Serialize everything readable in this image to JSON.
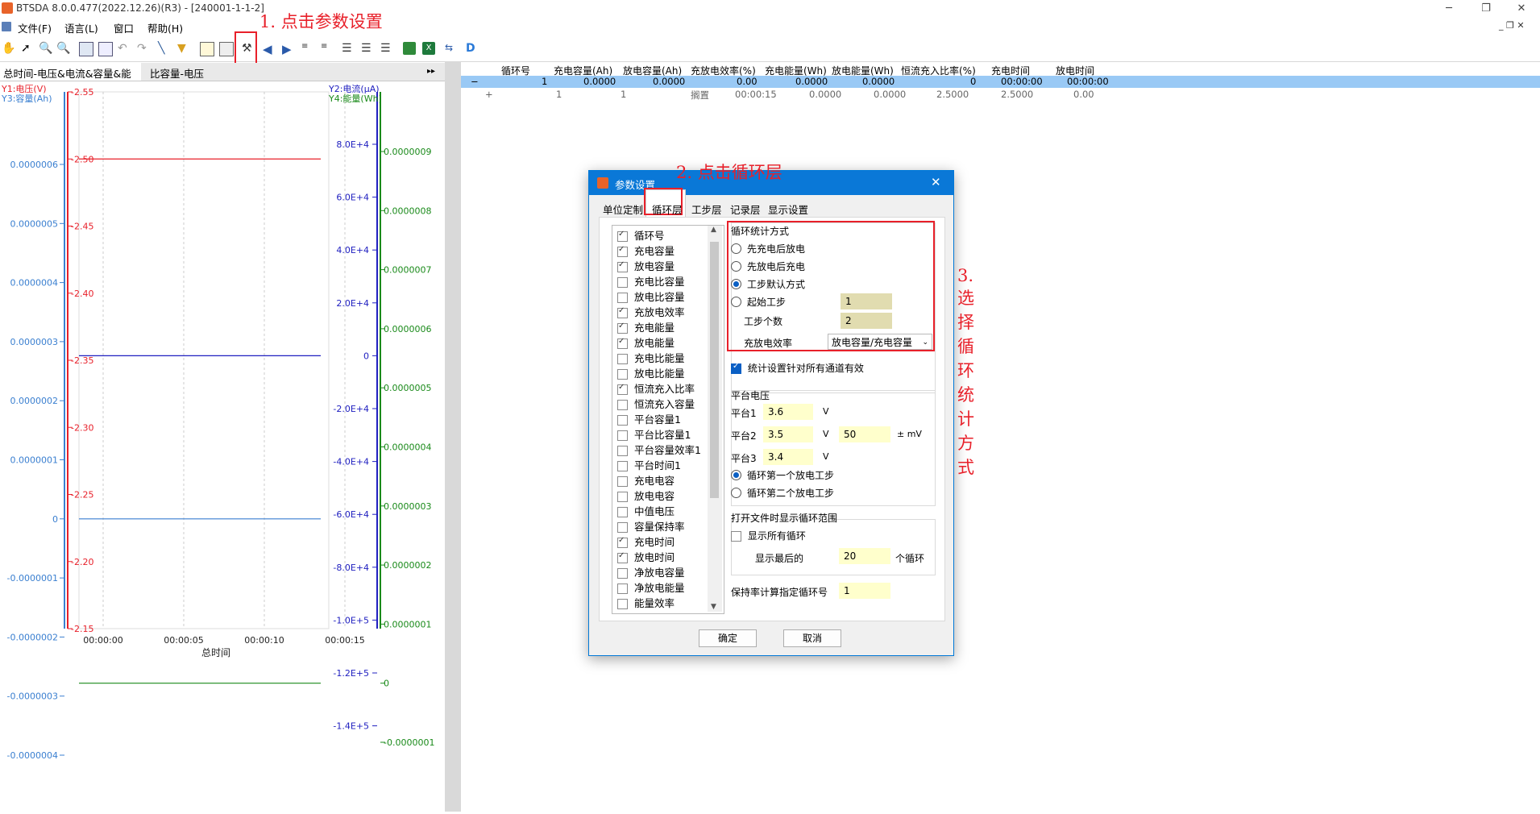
{
  "window": {
    "title": "BTSDA 8.0.0.477(2022.12.26)(R3) - [240001-1-1-2]",
    "minimize": "─",
    "restore": "❐",
    "close": "✕"
  },
  "menu": {
    "items": [
      "文件(F)",
      "语言(L)",
      "窗口",
      "帮助(H)"
    ]
  },
  "annotations": {
    "step1": "1. 点击参数设置",
    "step2": "2. 点击循环层",
    "step3": "3. 选择循环统计方式"
  },
  "left_panel": {
    "tabs": [
      "总时间-电压&电流&容量&能量",
      "比容量-电压"
    ],
    "arrow": "▸▸"
  },
  "chart_data": {
    "type": "line",
    "xlabel": "总时间",
    "x_ticks": [
      "00:00:00",
      "00:00:05",
      "00:00:10",
      "00:00:15"
    ],
    "axes": {
      "y1": {
        "label": "Y1:电压(V)",
        "color": "#e8202a",
        "ticks": [
          "2.55",
          "2.50",
          "2.45",
          "2.40",
          "2.35",
          "2.30",
          "2.25",
          "2.20",
          "2.15"
        ]
      },
      "y2": {
        "label": "Y2:电流(μA)",
        "color": "#2020c0",
        "ticks": [
          "8.0E+4",
          "6.0E+4",
          "4.0E+4",
          "2.0E+4",
          "0",
          "-2.0E+4",
          "-4.0E+4",
          "-6.0E+4",
          "-8.0E+4",
          "-1.0E+5",
          "-1.2E+5",
          "-1.4E+5"
        ]
      },
      "y3": {
        "label": "Y3:容量(Ah)",
        "color": "#3a7fd0",
        "ticks": [
          "0.0000006",
          "0.0000005",
          "0.0000004",
          "0.0000003",
          "0.0000002",
          "0.0000001",
          "0",
          "-0.0000001",
          "-0.0000002",
          "-0.0000003",
          "-0.0000004"
        ]
      },
      "y4": {
        "label": "Y4:能量(Wh)",
        "color": "#1a8a1a",
        "ticks": [
          "0.0000009",
          "0.0000008",
          "0.0000007",
          "0.0000006",
          "0.0000005",
          "0.0000004",
          "0.0000003",
          "0.0000002",
          "0.0000001",
          "0",
          "-0.0000001"
        ]
      }
    },
    "series": [
      {
        "name": "Y1:电压(V)",
        "color": "#e8202a",
        "x": [
          0,
          15
        ],
        "y": [
          2.5,
          2.5
        ]
      },
      {
        "name": "Y2:电流(μA)",
        "color": "#2020c0",
        "x": [
          0,
          15
        ],
        "y": [
          0,
          0
        ]
      },
      {
        "name": "Y3:容量(Ah)",
        "color": "#3a7fd0",
        "x": [
          0,
          15
        ],
        "y": [
          0,
          0
        ]
      },
      {
        "name": "Y4:能量(Wh)",
        "color": "#1a8a1a",
        "x": [
          0,
          15
        ],
        "y": [
          0,
          0
        ]
      }
    ]
  },
  "grid": {
    "headers": [
      "循环号",
      "充电容量(Ah)",
      "放电容量(Ah)",
      "充放电效率(%)",
      "充电能量(Wh)",
      "放电能量(Wh)",
      "恒流充入比率(%)",
      "充电时间",
      "放电时间"
    ],
    "row1": {
      "toggle": "−",
      "cells": [
        "1",
        "0.0000",
        "0.0000",
        "0.00",
        "0.0000",
        "0.0000",
        "0",
        "00:00:00",
        "00:00:00"
      ]
    },
    "row2": {
      "toggle": "+",
      "cells": [
        "1",
        "1",
        "搁置",
        "00:00:15",
        "0.0000",
        "0.0000",
        "2.5000",
        "2.5000",
        "0.00"
      ]
    }
  },
  "dialog": {
    "title": "参数设置",
    "close": "✕",
    "tabs": [
      "单位定制",
      "循环层",
      "工步层",
      "记录层",
      "显示设置"
    ],
    "columns": [
      {
        "label": "循环号",
        "checked": true
      },
      {
        "label": "充电容量",
        "checked": true
      },
      {
        "label": "放电容量",
        "checked": true
      },
      {
        "label": "充电比容量",
        "checked": false
      },
      {
        "label": "放电比容量",
        "checked": false
      },
      {
        "label": "充放电效率",
        "checked": true
      },
      {
        "label": "充电能量",
        "checked": true
      },
      {
        "label": "放电能量",
        "checked": true
      },
      {
        "label": "充电比能量",
        "checked": false
      },
      {
        "label": "放电比能量",
        "checked": false
      },
      {
        "label": "恒流充入比率",
        "checked": true
      },
      {
        "label": "恒流充入容量",
        "checked": false
      },
      {
        "label": "平台容量1",
        "checked": false
      },
      {
        "label": "平台比容量1",
        "checked": false
      },
      {
        "label": "平台容量效率1",
        "checked": false
      },
      {
        "label": "平台时间1",
        "checked": false
      },
      {
        "label": "充电电容",
        "checked": false
      },
      {
        "label": "放电电容",
        "checked": false
      },
      {
        "label": "中值电压",
        "checked": false
      },
      {
        "label": "容量保持率",
        "checked": false
      },
      {
        "label": "充电时间",
        "checked": true
      },
      {
        "label": "放电时间",
        "checked": true
      },
      {
        "label": "净放电容量",
        "checked": false
      },
      {
        "label": "净放电能量",
        "checked": false
      },
      {
        "label": "能量效率",
        "checked": false
      }
    ],
    "stat": {
      "title": "循环统计方式",
      "options": [
        {
          "label": "先充电后放电",
          "selected": false
        },
        {
          "label": "先放电后充电",
          "selected": false
        },
        {
          "label": "工步默认方式",
          "selected": true
        },
        {
          "label": "起始工步",
          "selected": false
        }
      ],
      "start_step": "1",
      "step_count_label": "工步个数",
      "step_count": "2",
      "efficiency_label": "充放电效率",
      "efficiency_value": "放电容量/充电容量",
      "apply_all": "统计设置针对所有通道有效",
      "apply_all_checked": true
    },
    "platform": {
      "title": "平台电压",
      "p1_label": "平台1",
      "p1_value": "3.6",
      "p1_unit": "V",
      "p2_label": "平台2",
      "p2_value": "3.5",
      "p2_unit": "V",
      "p2_tol": "50",
      "p2_tol_unit": "± mV",
      "p3_label": "平台3",
      "p3_value": "3.4",
      "p3_unit": "V",
      "opt1": "循环第一个放电工步",
      "opt1_selected": true,
      "opt2": "循环第二个放电工步",
      "opt2_selected": false
    },
    "open_range": {
      "title": "打开文件时显示循环范围",
      "show_all": "显示所有循环",
      "show_all_checked": false,
      "last_label": "显示最后的",
      "last_value": "20",
      "last_unit": "个循环"
    },
    "retention_label": "保持率计算指定循环号",
    "retention_value": "1",
    "ok": "确定",
    "cancel": "取消"
  }
}
